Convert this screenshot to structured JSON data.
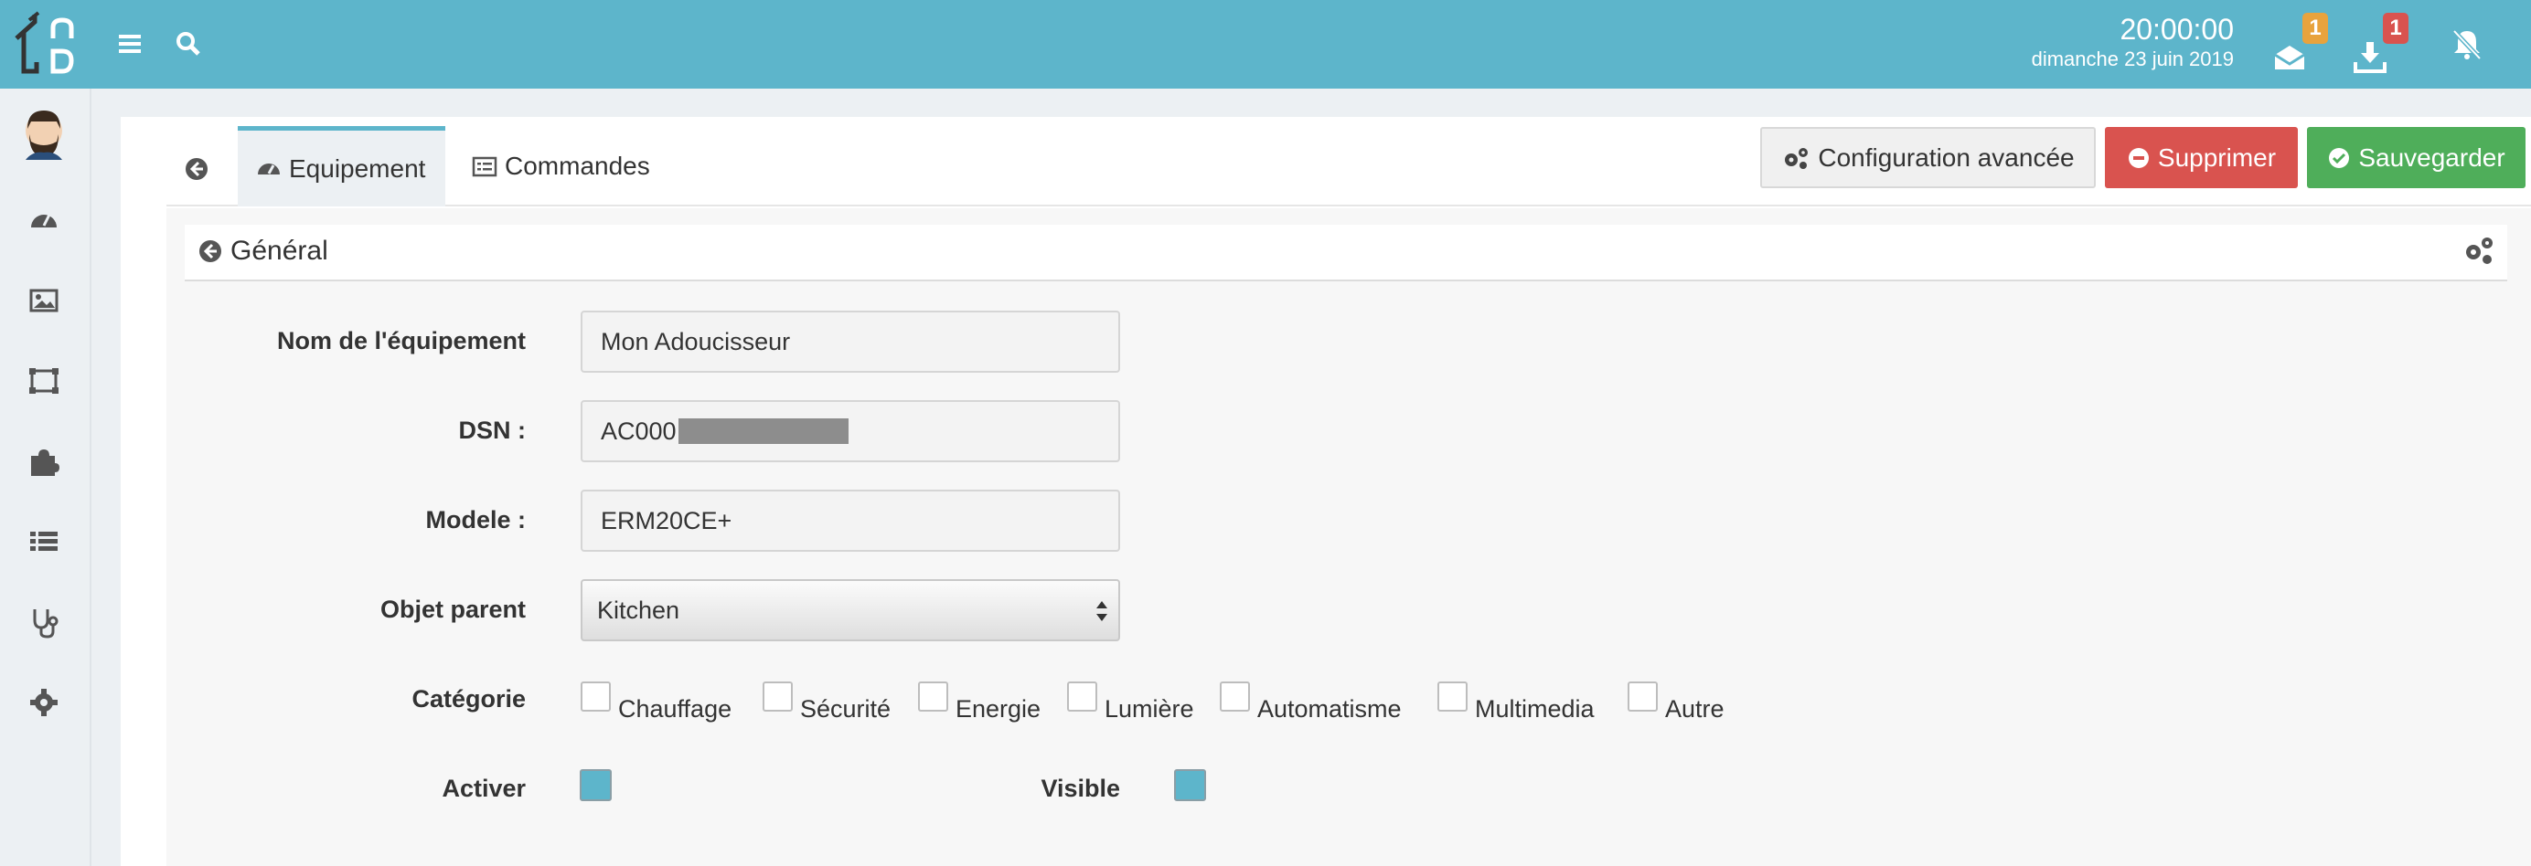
{
  "header": {
    "time": "20:00:00",
    "date": "dimanche 23 juin 2019",
    "messages_count": "1",
    "updates_count": "1",
    "colors": {
      "bar": "#5db5cb",
      "badge_orange": "#e8a33d",
      "badge_red": "#d9534f"
    }
  },
  "sidebar": {
    "items": [
      "avatar",
      "dashboard-icon",
      "image-icon",
      "object-icon",
      "plugin-icon",
      "list-icon",
      "stethoscope-icon",
      "gear-icon"
    ]
  },
  "tabs": {
    "equipement": "Equipement",
    "commandes": "Commandes"
  },
  "actions": {
    "config": "Configuration avancée",
    "delete": "Supprimer",
    "save": "Sauvegarder",
    "colors": {
      "delete": "#d9534f",
      "save": "#4fae5a"
    }
  },
  "section": {
    "title": "Général"
  },
  "form": {
    "name_label": "Nom de l'équipement",
    "name_value": "Mon Adoucisseur",
    "dsn_label": "DSN :",
    "dsn_value": "AC000",
    "model_label": "Modele :",
    "model_value": "ERM20CE+",
    "parent_label": "Objet parent",
    "parent_value": "Kitchen",
    "category_label": "Catégorie",
    "categories": [
      "Chauffage",
      "Sécurité",
      "Energie",
      "Lumière",
      "Automatisme",
      "Multimedia",
      "Autre"
    ],
    "activate_label": "Activer",
    "visible_label": "Visible"
  }
}
